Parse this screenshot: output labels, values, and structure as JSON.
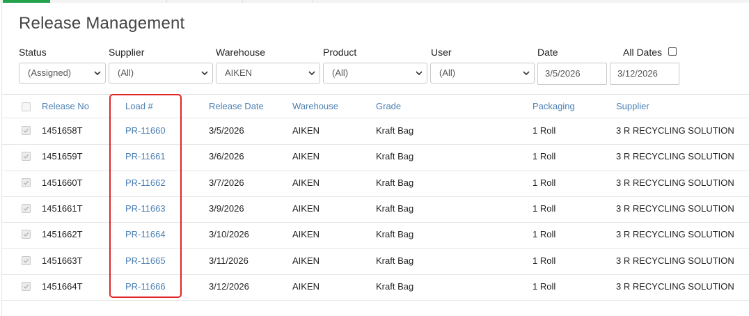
{
  "page": {
    "title": "Release Management"
  },
  "filters": {
    "status": {
      "label": "Status",
      "value": "(Assigned)"
    },
    "supplier": {
      "label": "Supplier",
      "value": "(All)"
    },
    "warehouse": {
      "label": "Warehouse",
      "value": "AIKEN"
    },
    "product": {
      "label": "Product",
      "value": "(All)"
    },
    "user": {
      "label": "User",
      "value": "(All)"
    },
    "date": {
      "label": "Date",
      "from": "3/5/2026",
      "to": "3/12/2026"
    },
    "all_dates": {
      "label": "All Dates",
      "checked": false
    }
  },
  "table": {
    "columns": [
      "Release No",
      "Load #",
      "Release Date",
      "Warehouse",
      "Grade",
      "Packaging",
      "Supplier"
    ],
    "rows": [
      {
        "release_no": "1451658T",
        "load": "PR-11660",
        "release_date": "3/5/2026",
        "warehouse": "AIKEN",
        "grade": "Kraft Bag",
        "packaging": "1 Roll",
        "supplier": "3 R RECYCLING SOLUTION"
      },
      {
        "release_no": "1451659T",
        "load": "PR-11661",
        "release_date": "3/6/2026",
        "warehouse": "AIKEN",
        "grade": "Kraft Bag",
        "packaging": "1 Roll",
        "supplier": "3 R RECYCLING SOLUTION"
      },
      {
        "release_no": "1451660T",
        "load": "PR-11662",
        "release_date": "3/7/2026",
        "warehouse": "AIKEN",
        "grade": "Kraft Bag",
        "packaging": "1 Roll",
        "supplier": "3 R RECYCLING SOLUTION"
      },
      {
        "release_no": "1451661T",
        "load": "PR-11663",
        "release_date": "3/9/2026",
        "warehouse": "AIKEN",
        "grade": "Kraft Bag",
        "packaging": "1 Roll",
        "supplier": "3 R RECYCLING SOLUTION"
      },
      {
        "release_no": "1451662T",
        "load": "PR-11664",
        "release_date": "3/10/2026",
        "warehouse": "AIKEN",
        "grade": "Kraft Bag",
        "packaging": "1 Roll",
        "supplier": "3 R RECYCLING SOLUTION"
      },
      {
        "release_no": "1451663T",
        "load": "PR-11665",
        "release_date": "3/11/2026",
        "warehouse": "AIKEN",
        "grade": "Kraft Bag",
        "packaging": "1 Roll",
        "supplier": "3 R RECYCLING SOLUTION"
      },
      {
        "release_no": "1451664T",
        "load": "PR-11666",
        "release_date": "3/12/2026",
        "warehouse": "AIKEN",
        "grade": "Kraft Bag",
        "packaging": "1 Roll",
        "supplier": "3 R RECYCLING SOLUTION"
      }
    ]
  },
  "colors": {
    "accent": "#22a24a",
    "link": "#4a7fb3",
    "highlight": "#e02424"
  },
  "icons": {
    "dropdown": "chevron-down-icon",
    "checked": "checkmark-icon"
  }
}
